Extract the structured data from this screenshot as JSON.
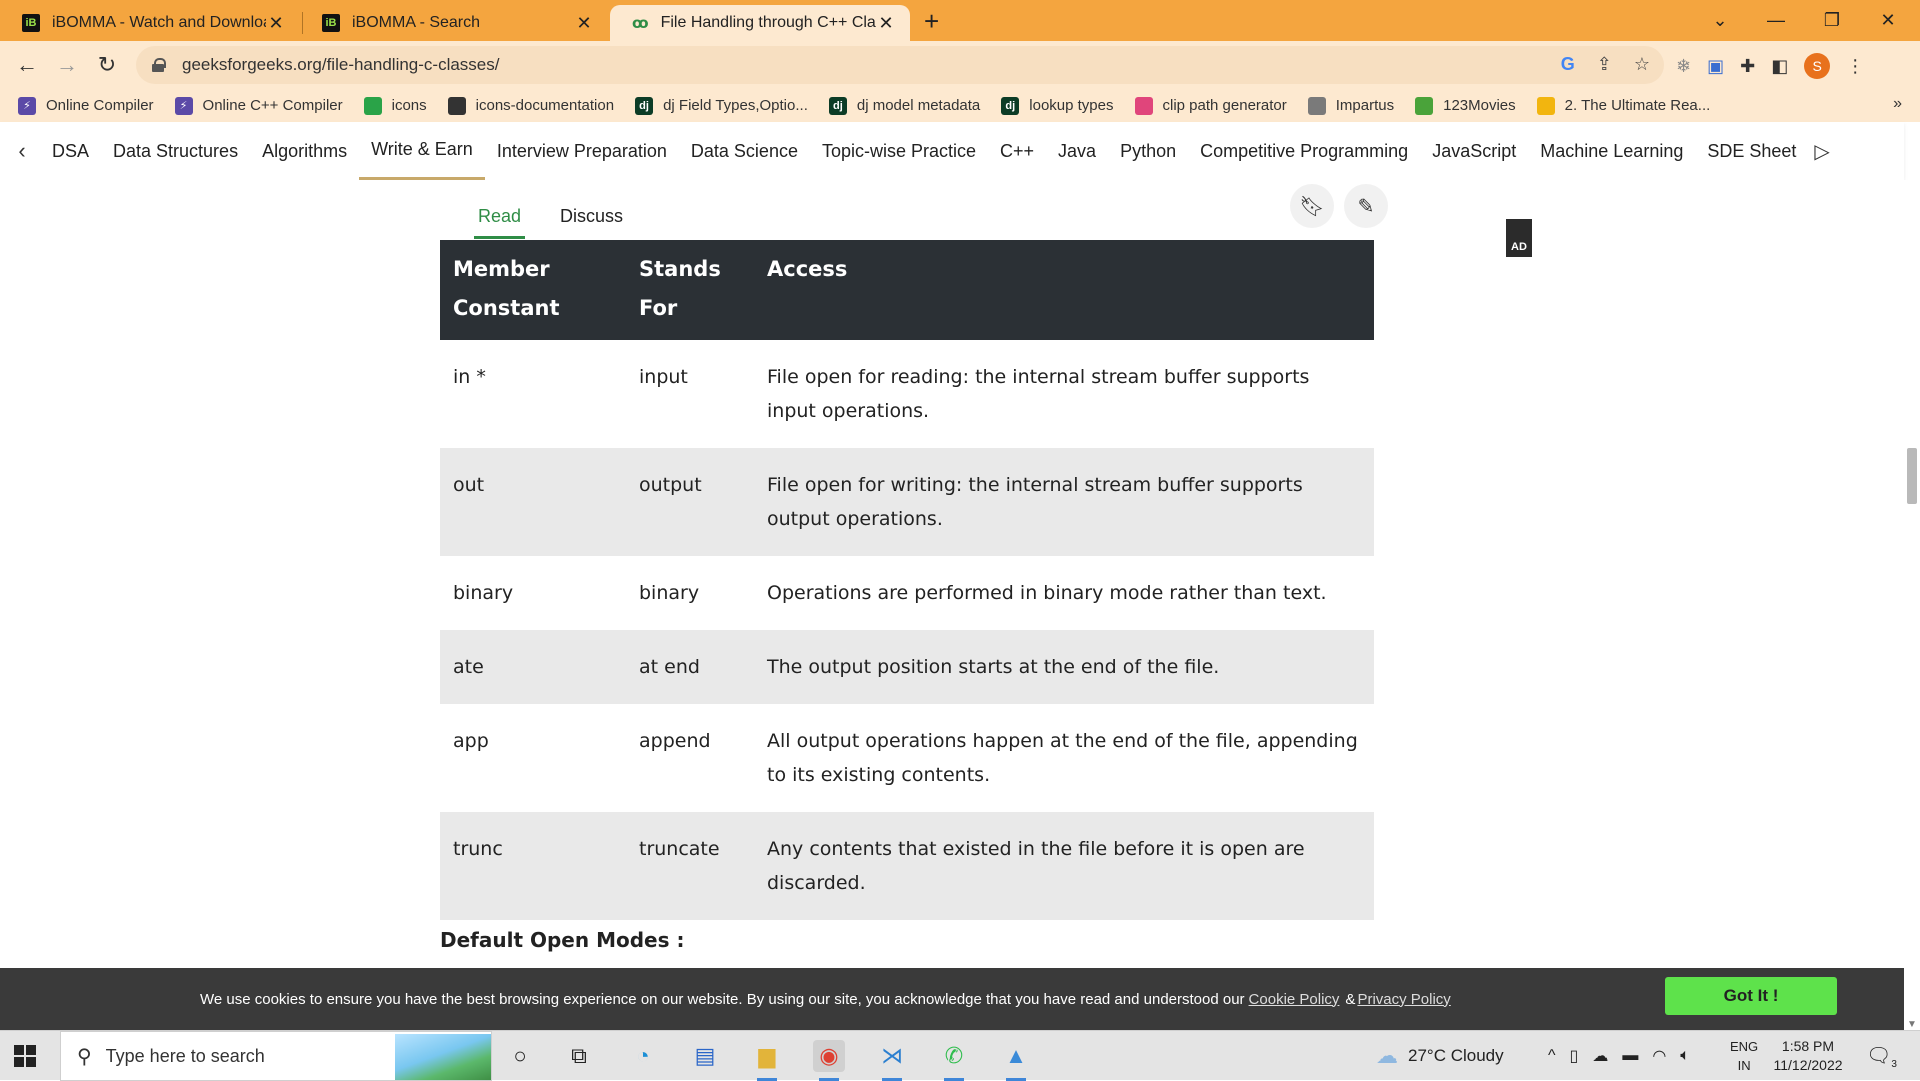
{
  "browser": {
    "tabs": [
      {
        "title": "iBOMMA - Watch and Download",
        "favicon": "iB"
      },
      {
        "title": "iBOMMA - Search",
        "favicon": "iB"
      },
      {
        "title": "File Handling through C++ Class",
        "favicon": "gfg"
      }
    ],
    "new_tab_label": "+",
    "url": "geeksforgeeks.org/file-handling-c-classes/",
    "profile_initial": "S",
    "bookmarks": [
      {
        "label": "Online Compiler",
        "icon": "bolt-icon",
        "color": "#5b4aa7"
      },
      {
        "label": "Online C++ Compiler",
        "icon": "bolt-icon",
        "color": "#5b4aa7"
      },
      {
        "label": "icons",
        "icon": "grid-icon",
        "color": "#2aa348"
      },
      {
        "label": "icons-documentation",
        "icon": "globe-icon",
        "color": "#333333"
      },
      {
        "label": "dj Field Types,Optio...",
        "icon": "dj",
        "color": "#0c3c26"
      },
      {
        "label": "dj model metadata",
        "icon": "dj",
        "color": "#0c3c26"
      },
      {
        "label": "lookup types",
        "icon": "dj",
        "color": "#0c3c26"
      },
      {
        "label": "clip path generator",
        "icon": "dots-icon",
        "color": "#e0457b"
      },
      {
        "label": "Impartus",
        "icon": "globe-icon",
        "color": "#7a7a7a"
      },
      {
        "label": "123Movies",
        "icon": "reel-icon",
        "color": "#4aa33a"
      },
      {
        "label": "2. The Ultimate Rea...",
        "icon": "drive-icon",
        "color": "#f2b50f"
      }
    ],
    "bookmarks_more": "»"
  },
  "gfg_nav": {
    "items": [
      "DSA",
      "Data Structures",
      "Algorithms",
      "Write & Earn",
      "Interview Preparation",
      "Data Science",
      "Topic-wise Practice",
      "C++",
      "Java",
      "Python",
      "Competitive Programming",
      "JavaScript",
      "Machine Learning",
      "SDE Sheet"
    ],
    "active": "Write & Earn"
  },
  "article": {
    "tabs": {
      "read": "Read",
      "discuss": "Discuss"
    },
    "ad_label": "AD",
    "table": {
      "headers": [
        "Member Constant",
        "Stands For",
        "Access"
      ],
      "rows": [
        [
          "in *",
          "input",
          "File open for reading: the internal stream buffer supports input operations."
        ],
        [
          "out",
          "output",
          "File open for writing: the internal stream buffer supports output operations."
        ],
        [
          "binary",
          "binary",
          "Operations are performed in binary mode rather than text."
        ],
        [
          "ate",
          "at end",
          "The output position starts at the end of the file."
        ],
        [
          "app",
          "append",
          "All output operations happen at the end of the file, appending to its existing contents."
        ],
        [
          "trunc",
          "truncate",
          "Any contents that existed in the file before it is open are discarded."
        ]
      ]
    },
    "subheading": "Default Open Modes :"
  },
  "cookie": {
    "text": "We use cookies to ensure you have the best browsing experience on our website. By using our site, you acknowledge that you have read and understood our",
    "cookie_policy": "Cookie Policy",
    "amp": "&",
    "privacy_policy": "Privacy Policy",
    "button": "Got It !"
  },
  "taskbar": {
    "search_placeholder": "Type here to search",
    "weather": "27°C  Cloudy",
    "lang_top": "ENG",
    "lang_bottom": "IN",
    "time": "1:58 PM",
    "date": "11/12/2022",
    "notif_count": "3"
  },
  "colors": {
    "accent_green": "#2f8d46",
    "tab_bar": "#f4a53f",
    "table_header": "#2b3035",
    "got_it": "#5ee24b"
  }
}
